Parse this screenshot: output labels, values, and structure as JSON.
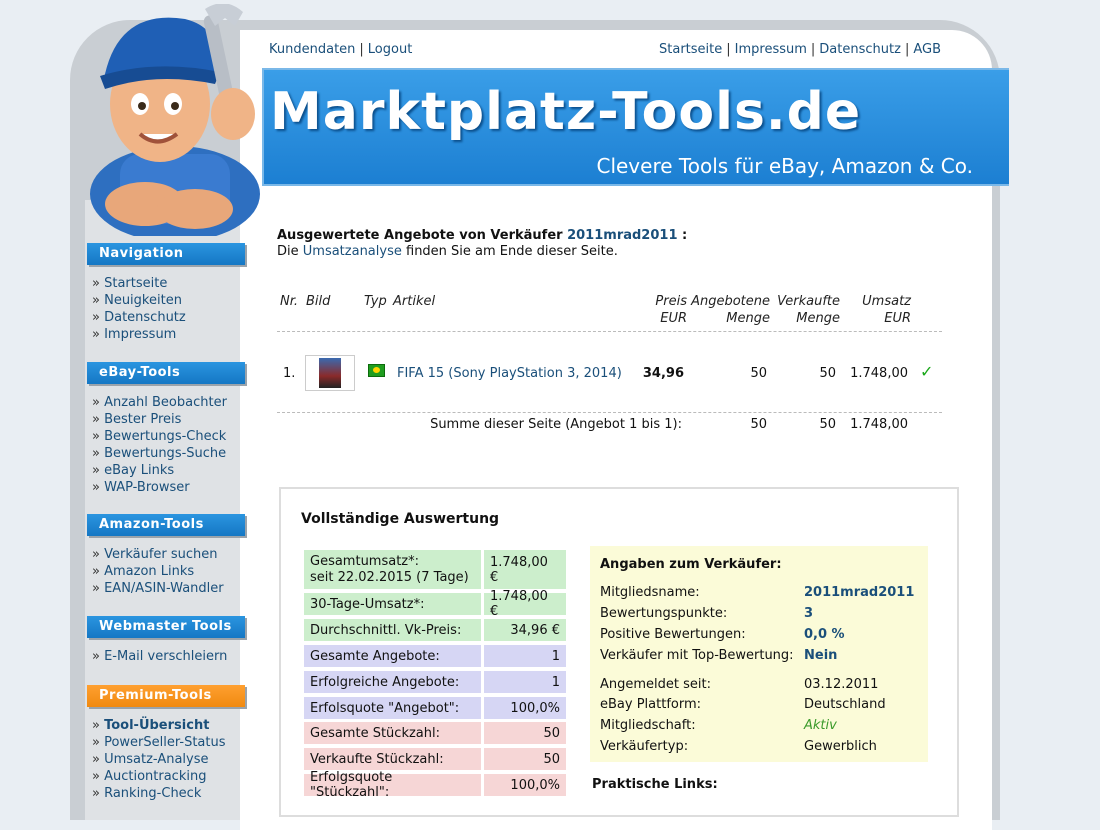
{
  "topnav_left": [
    "Kundendaten",
    "Logout"
  ],
  "topnav_right": [
    "Startseite",
    "Impressum",
    "Datenschutz",
    "AGB"
  ],
  "banner": {
    "title": "Marktplatz-Tools.de",
    "subtitle": "Clevere Tools für eBay, Amazon & Co."
  },
  "sidebar": {
    "navigation": {
      "title": "Navigation",
      "items": [
        "Startseite",
        "Neuigkeiten",
        "Datenschutz",
        "Impressum"
      ]
    },
    "ebay": {
      "title": "eBay-Tools",
      "items": [
        "Anzahl Beobachter",
        "Bester Preis",
        "Bewertungs-Check",
        "Bewertungs-Suche",
        "eBay Links",
        "WAP-Browser"
      ]
    },
    "amazon": {
      "title": "Amazon-Tools",
      "items": [
        "Verkäufer suchen",
        "Amazon Links",
        "EAN/ASIN-Wandler"
      ]
    },
    "webmaster": {
      "title": "Webmaster Tools",
      "items": [
        "E-Mail verschleiern"
      ]
    },
    "premium": {
      "title": "Premium-Tools",
      "items": [
        "Tool-Übersicht",
        "PowerSeller-Status",
        "Umsatz-Analyse",
        "Auctiontracking",
        "Ranking-Check"
      ]
    }
  },
  "main": {
    "title_prefix": "Ausgewertete Angebote von Verkäufer",
    "seller_name": "2011mrad2011",
    "title_suffix": ":",
    "subline_prefix": "Die",
    "subline_link": "Umsatzanalyse",
    "subline_suffix": "finden Sie am Ende dieser Seite.",
    "columns": {
      "nr": "Nr.",
      "bild": "Bild",
      "typ": "Typ",
      "artikel": "Artikel",
      "preis_1": "Preis",
      "preis_2": "EUR",
      "angebotene_1": "Angebotene",
      "angebotene_2": "Menge",
      "verkaufte_1": "Verkaufte",
      "verkaufte_2": "Menge",
      "umsatz_1": "Umsatz",
      "umsatz_2": "EUR"
    },
    "row": {
      "nr": "1.",
      "artikel": "FIFA 15 (Sony PlayStation 3, 2014)",
      "preis": "34,96",
      "angebotene": "50",
      "verkaufte": "50",
      "umsatz": "1.748,00",
      "status_icon": "check-icon"
    },
    "sum": {
      "label": "Summe dieser Seite (Angebot 1 bis 1):",
      "angebotene": "50",
      "verkaufte": "50",
      "umsatz": "1.748,00"
    }
  },
  "panel": {
    "title": "Vollständige Auswertung",
    "stats": [
      {
        "label_1": "Gesamtumsatz*:",
        "label_2": "seit 22.02.2015 (7 Tage)",
        "value": "1.748,00 €",
        "color": "green"
      },
      {
        "label_1": "30-Tage-Umsatz*:",
        "value": "1.748,00 €",
        "color": "green"
      },
      {
        "label_1": "Durchschnittl. Vk-Preis:",
        "value": "34,96 €",
        "color": "green"
      },
      {
        "label_1": "Gesamte Angebote:",
        "value": "1",
        "color": "blue"
      },
      {
        "label_1": "Erfolgreiche Angebote:",
        "value": "1",
        "color": "blue"
      },
      {
        "label_1": "Erfolsquote \"Angebot\":",
        "value": "100,0%",
        "color": "blue"
      },
      {
        "label_1": "Gesamte Stückzahl:",
        "value": "50",
        "color": "pink"
      },
      {
        "label_1": "Verkaufte Stückzahl:",
        "value": "50",
        "color": "pink"
      },
      {
        "label_1": "Erfolgsquote \"Stückzahl\":",
        "value": "100,0%",
        "color": "pink"
      }
    ],
    "seller_box": {
      "title": "Angaben zum Verkäufer:",
      "fields": [
        {
          "label": "Mitgliedsname:",
          "value": "2011mrad2011"
        },
        {
          "label": "Bewertungspunkte:",
          "value": "3"
        },
        {
          "label": "Positive Bewertungen:",
          "value": "0,0 %"
        },
        {
          "label": "Verkäufer mit Top-Bewertung:",
          "value": "Nein"
        },
        {
          "label": "Angemeldet seit:",
          "value": "03.12.2011"
        },
        {
          "label": "eBay Plattform:",
          "value": "Deutschland"
        },
        {
          "label": "Mitgliedschaft:",
          "value": "Aktiv"
        },
        {
          "label": "Verkäufertyp:",
          "value": "Gewerblich"
        }
      ]
    },
    "links_title": "Praktische Links:"
  }
}
